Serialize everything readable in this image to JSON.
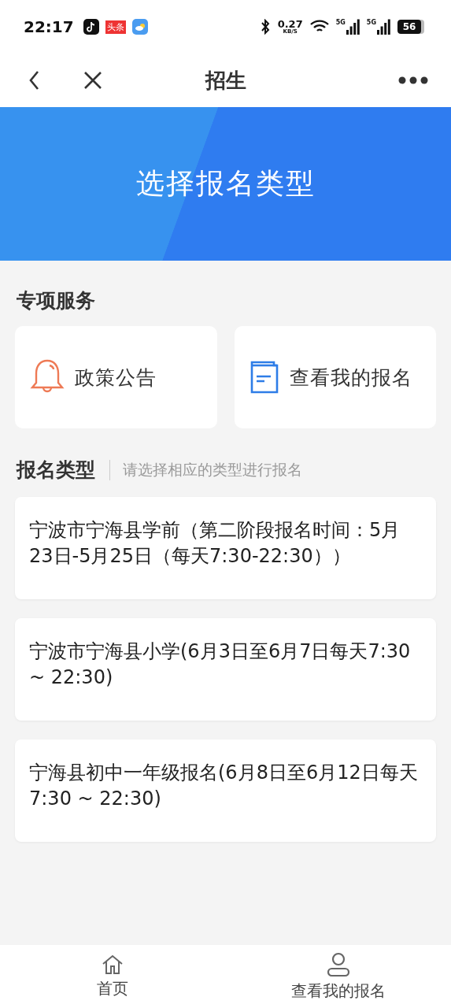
{
  "status_bar": {
    "time": "22:17",
    "news_badge": "头条",
    "speed_value": "0.27",
    "speed_unit": "KB/S",
    "signal_1_label": "5G",
    "signal_2_label": "5G",
    "battery": "56"
  },
  "nav": {
    "title": "招生"
  },
  "banner": {
    "title": "选择报名类型"
  },
  "services": {
    "title": "专项服务",
    "items": [
      {
        "kind": "bell",
        "label": "政策公告"
      },
      {
        "kind": "document",
        "label": "查看我的报名"
      }
    ]
  },
  "types": {
    "title": "报名类型",
    "hint": "请选择相应的类型进行报名",
    "items": [
      {
        "label": "宁波市宁海县学前（第二阶段报名时间：5月23日-5月25日（每天7:30-22:30））"
      },
      {
        "label": "宁波市宁海县小学(6月3日至6月7日每天7:30 ~ 22:30)"
      },
      {
        "label": "宁海县初中一年级报名(6月8日至6月12日每天7:30 ~ 22:30)"
      }
    ]
  },
  "tab_bar": [
    {
      "kind": "home",
      "label": "首页"
    },
    {
      "kind": "person",
      "label": "查看我的报名"
    }
  ]
}
